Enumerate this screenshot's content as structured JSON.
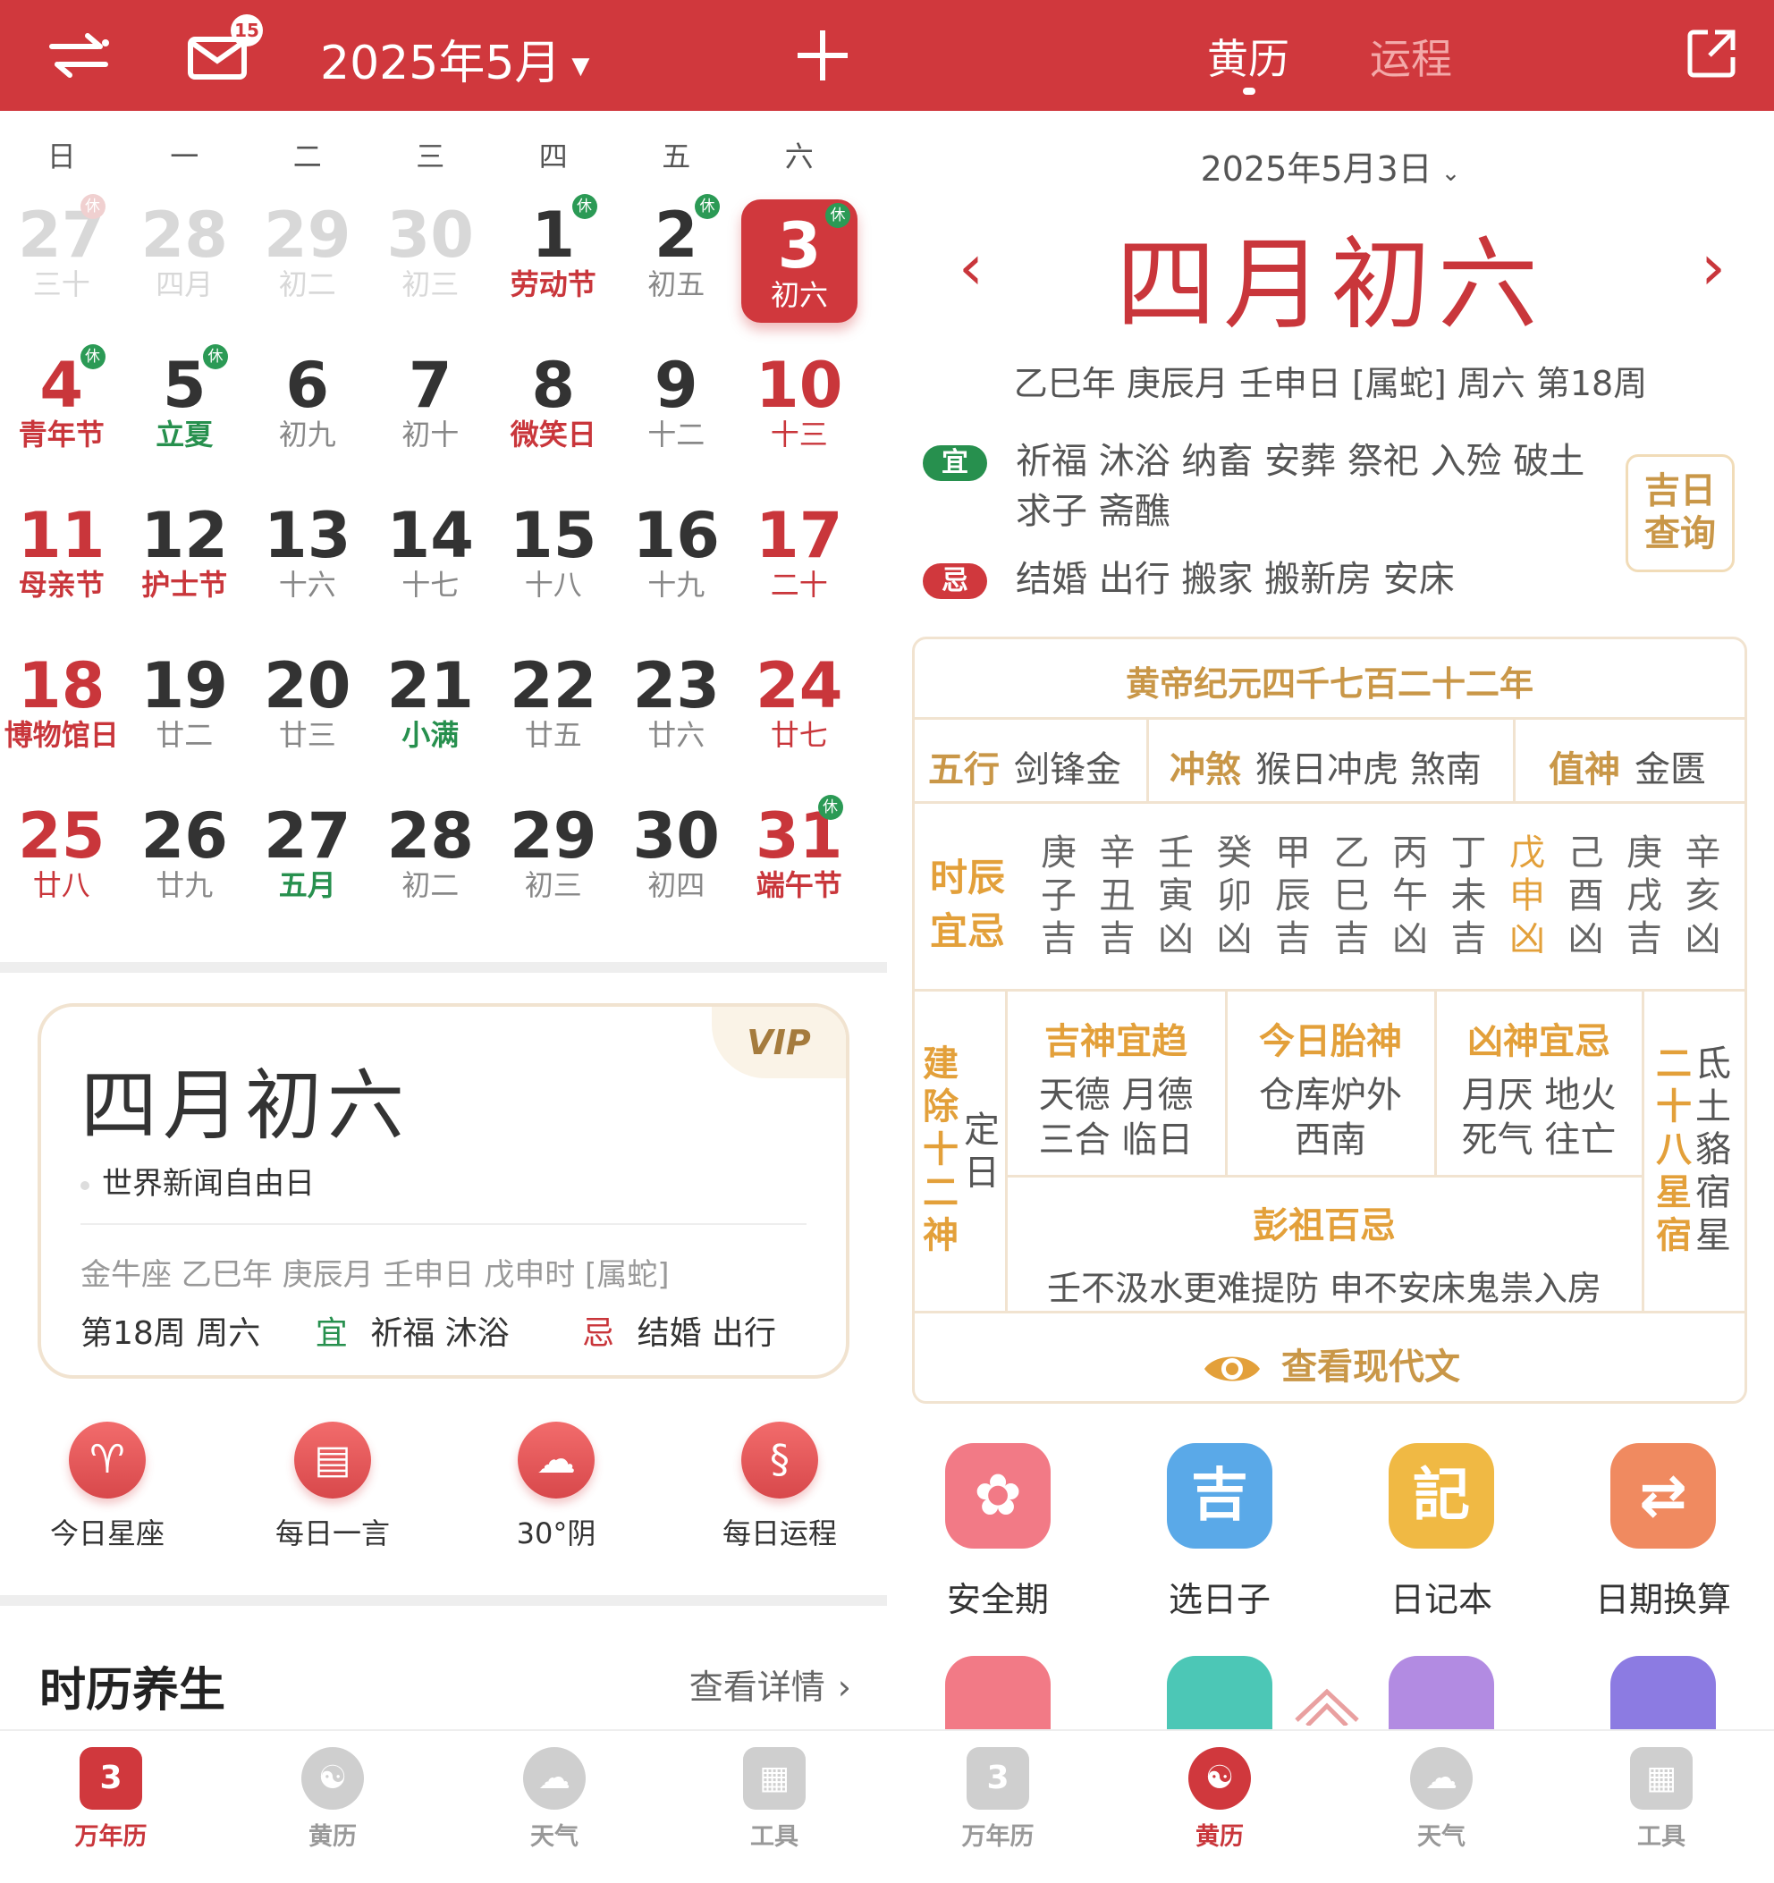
{
  "left": {
    "header": {
      "month_label": "2025年5月",
      "mail_badge": "15"
    },
    "weekdays": [
      "日",
      "一",
      "二",
      "三",
      "四",
      "五",
      "六"
    ],
    "cells": [
      {
        "n": "27",
        "s": "三十",
        "t": "dim",
        "hol": "休"
      },
      {
        "n": "28",
        "s": "四月",
        "t": "dim"
      },
      {
        "n": "29",
        "s": "初二",
        "t": "dim"
      },
      {
        "n": "30",
        "s": "初三",
        "t": "dim"
      },
      {
        "n": "1",
        "s": "劳动节",
        "t": "holi",
        "hol": "休"
      },
      {
        "n": "2",
        "s": "初五",
        "t": "",
        "hol": "休"
      },
      {
        "n": "3",
        "s": "初六",
        "t": "sel",
        "hol": "休"
      },
      {
        "n": "4",
        "s": "青年节",
        "t": "wkend holi",
        "hol": "休"
      },
      {
        "n": "5",
        "s": "立夏",
        "t": "term",
        "hol": "休"
      },
      {
        "n": "6",
        "s": "初九",
        "t": ""
      },
      {
        "n": "7",
        "s": "初十",
        "t": ""
      },
      {
        "n": "8",
        "s": "微笑日",
        "t": "holi"
      },
      {
        "n": "9",
        "s": "十二",
        "t": ""
      },
      {
        "n": "10",
        "s": "十三",
        "t": "wkend"
      },
      {
        "n": "11",
        "s": "母亲节",
        "t": "wkend holi"
      },
      {
        "n": "12",
        "s": "护士节",
        "t": "holi"
      },
      {
        "n": "13",
        "s": "十六",
        "t": ""
      },
      {
        "n": "14",
        "s": "十七",
        "t": ""
      },
      {
        "n": "15",
        "s": "十八",
        "t": ""
      },
      {
        "n": "16",
        "s": "十九",
        "t": ""
      },
      {
        "n": "17",
        "s": "二十",
        "t": "wkend"
      },
      {
        "n": "18",
        "s": "博物馆日",
        "t": "wkend holi"
      },
      {
        "n": "19",
        "s": "廿二",
        "t": ""
      },
      {
        "n": "20",
        "s": "廿三",
        "t": ""
      },
      {
        "n": "21",
        "s": "小满",
        "t": "term"
      },
      {
        "n": "22",
        "s": "廿五",
        "t": ""
      },
      {
        "n": "23",
        "s": "廿六",
        "t": ""
      },
      {
        "n": "24",
        "s": "廿七",
        "t": "wkend"
      },
      {
        "n": "25",
        "s": "廿八",
        "t": "wkend"
      },
      {
        "n": "26",
        "s": "廿九",
        "t": ""
      },
      {
        "n": "27",
        "s": "五月",
        "t": "term"
      },
      {
        "n": "28",
        "s": "初二",
        "t": ""
      },
      {
        "n": "29",
        "s": "初三",
        "t": ""
      },
      {
        "n": "30",
        "s": "初四",
        "t": ""
      },
      {
        "n": "31",
        "s": "端午节",
        "t": "wkend holi",
        "hol": "休"
      }
    ],
    "card": {
      "vip": "VIP",
      "title": "四月初六",
      "festival": "世界新闻自由日",
      "info": "金牛座 乙巳年 庚辰月 壬申日 戊申时 [属蛇]",
      "week": "第18周 周六",
      "yi_label": "宜",
      "yi": "祈福 沐浴",
      "ji_label": "忌",
      "ji": "结婚 出行"
    },
    "quick": [
      {
        "icon": "♈",
        "label": "今日星座"
      },
      {
        "icon": "▤",
        "label": "每日一言"
      },
      {
        "icon": "☁",
        "label": "30°阴"
      },
      {
        "icon": "§",
        "label": "每日运程"
      }
    ],
    "section": {
      "title": "时历养生",
      "more": "查看详情"
    },
    "tabs": [
      {
        "icon": "3",
        "label": "万年历"
      },
      {
        "icon": "☯",
        "label": "黄历"
      },
      {
        "icon": "☁",
        "label": "天气"
      },
      {
        "icon": "▦",
        "label": "工具"
      }
    ]
  },
  "right": {
    "tabs": {
      "active": "黄历",
      "other": "运程"
    },
    "date": "2025年5月3日",
    "lunar": "四月初六",
    "ganzhi": "乙巳年 庚辰月 壬申日 [属蛇] 周六 第18周",
    "yi_label": "宜",
    "yi": "祈福 沐浴 纳畜 安葬 祭祀 入殓 破土",
    "yi2": "求子 斋醮",
    "ji_label": "忌",
    "ji": "结婚 出行 搬家 搬新房 安床",
    "jiri": "吉日查询",
    "era": "黄帝纪元四千七百二十二年",
    "wuxing_label": "五行",
    "wuxing": "剑锋金",
    "chongsha_label": "冲煞",
    "chongsha": "猴日冲虎 煞南",
    "zhishen_label": "值神",
    "zhishen": "金匮",
    "shichen_label": "时辰宜忌",
    "shichen": [
      [
        "庚",
        "子",
        "吉"
      ],
      [
        "辛",
        "丑",
        "吉"
      ],
      [
        "壬",
        "寅",
        "凶"
      ],
      [
        "癸",
        "卯",
        "凶"
      ],
      [
        "甲",
        "辰",
        "吉"
      ],
      [
        "乙",
        "巳",
        "吉"
      ],
      [
        "丙",
        "午",
        "凶"
      ],
      [
        "丁",
        "未",
        "吉"
      ],
      [
        "戊",
        "申",
        "凶"
      ],
      [
        "己",
        "酉",
        "凶"
      ],
      [
        "庚",
        "戌",
        "吉"
      ],
      [
        "辛",
        "亥",
        "凶"
      ]
    ],
    "jianchu_label": "建除十二神",
    "jianchu": "定日",
    "jishen_label": "吉神宜趋",
    "jishen": "天德 月德 三合 临日",
    "taishen_label": "今日胎神",
    "taishen": "仓库炉外 西南",
    "xiongshen_label": "凶神宜忌",
    "xiongshen": "月厌 地火 死气 往亡",
    "xingxiu_label": "二十八星宿",
    "xingxiu": "氐土貉宿星",
    "pengzu_label": "彭祖百忌",
    "pengzu": "壬不汲水更难提防 申不安床鬼祟入房",
    "modern": "查看现代文",
    "tools": [
      {
        "icon": "✿",
        "label": "安全期",
        "color": "#f27a86"
      },
      {
        "icon": "吉",
        "label": "选日子",
        "color": "#5aa9e8"
      },
      {
        "icon": "記",
        "label": "日记本",
        "color": "#f0b944"
      },
      {
        "icon": "⇄",
        "label": "日期换算",
        "color": "#f08a60"
      }
    ],
    "bottom_tabs": [
      {
        "icon": "3",
        "label": "万年历"
      },
      {
        "icon": "☯",
        "label": "黄历"
      },
      {
        "icon": "☁",
        "label": "天气"
      },
      {
        "icon": "▦",
        "label": "工具"
      }
    ]
  }
}
